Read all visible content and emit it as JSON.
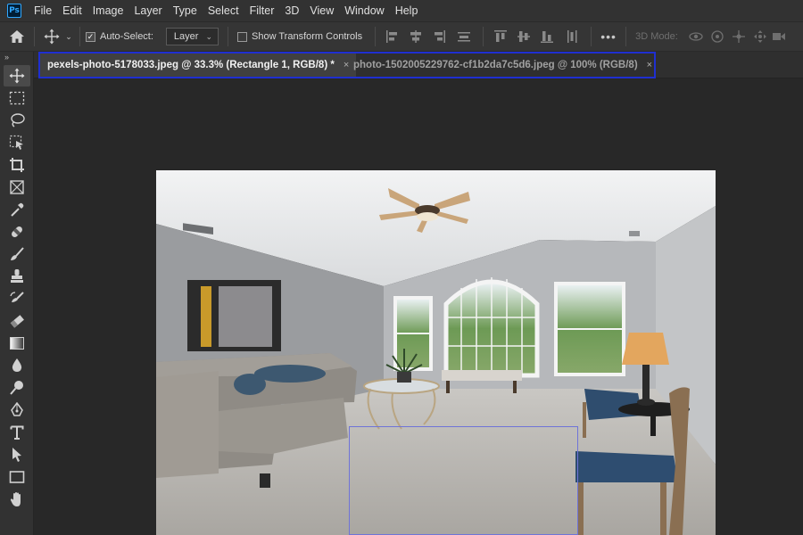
{
  "app": {
    "logo_text": "Ps"
  },
  "menu": [
    "File",
    "Edit",
    "Image",
    "Layer",
    "Type",
    "Select",
    "Filter",
    "3D",
    "View",
    "Window",
    "Help"
  ],
  "options": {
    "auto_select_label": "Auto-Select:",
    "auto_select_checked": true,
    "target_value": "Layer",
    "transform_label": "Show Transform Controls",
    "transform_checked": false,
    "mode_3d_label": "3D Mode:"
  },
  "tabs": [
    {
      "label": "pexels-photo-5178033.jpeg @ 33.3% (Rectangle 1, RGB/8) *",
      "active": true
    },
    {
      "label": "photo-1502005229762-cf1b2da7c5d6.jpeg @ 100% (RGB/8)",
      "active": false
    }
  ],
  "tabs_close_glyph": "×",
  "tools": [
    "move-tool-icon",
    "rectangular-marquee-icon",
    "lasso-icon",
    "object-selection-icon",
    "crop-icon",
    "frame-icon",
    "eyedropper-icon",
    "healing-brush-icon",
    "brush-icon",
    "clone-stamp-icon",
    "history-brush-icon",
    "eraser-icon",
    "gradient-icon",
    "blur-icon",
    "dodge-icon",
    "pen-icon",
    "type-icon",
    "path-selection-icon",
    "rectangle-icon",
    "hand-icon"
  ],
  "colors": {
    "tab_highlight": "#1f2fd1",
    "selection": "#6f74d8",
    "ps_blue": "#31a8ff"
  }
}
